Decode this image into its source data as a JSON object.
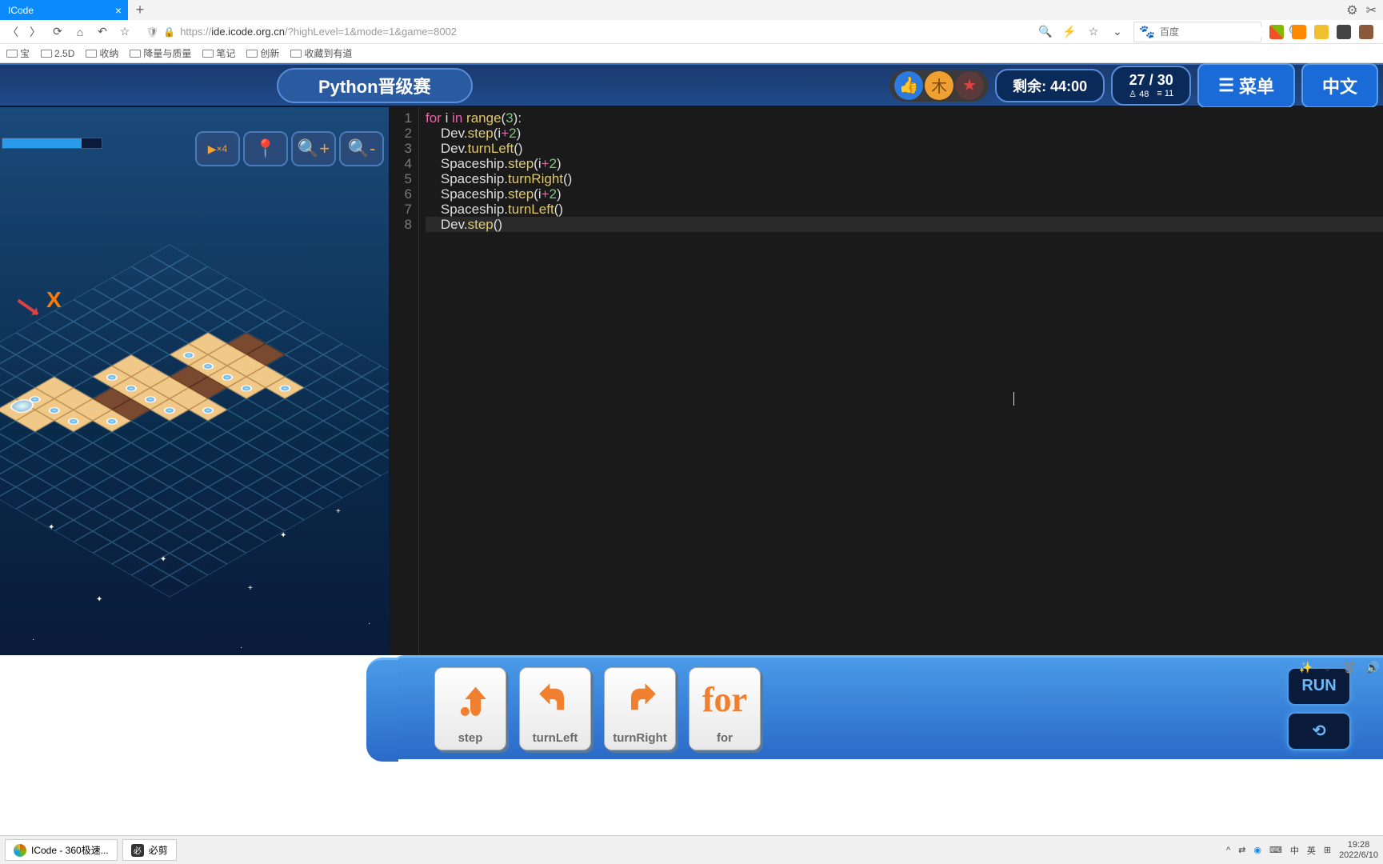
{
  "browser": {
    "tab_title": "ICode",
    "url_host": "ide.icode.org.cn",
    "url_path": "/?highLevel=1&mode=1&game=8002",
    "url_scheme": "https://",
    "search_placeholder": "百度",
    "bookmarks": [
      "宝",
      "2.5D",
      "收纳",
      "降量与质量",
      "笔记",
      "创新",
      "收藏到有道"
    ]
  },
  "header": {
    "title": "Python晋级赛",
    "timer_label": "剩余:",
    "timer_value": "44:00",
    "progress_cur": "27",
    "progress_total": "30",
    "stat_gold": "48",
    "stat_lines": "11",
    "menu_label": "菜单",
    "lang_label": "中文"
  },
  "game": {
    "x_label": "X",
    "btn_speed": "×4"
  },
  "code": {
    "lines": [
      {
        "n": "1",
        "indent": "",
        "tokens": [
          [
            "kw",
            "for"
          ],
          [
            "",
            " "
          ],
          [
            "",
            "i"
          ],
          [
            "",
            " "
          ],
          [
            "kw",
            "in"
          ],
          [
            "",
            " "
          ],
          [
            "fn",
            "range"
          ],
          [
            "",
            "("
          ],
          [
            "num",
            "3"
          ],
          [
            "",
            "):"
          ]
        ]
      },
      {
        "n": "2",
        "indent": "    ",
        "tokens": [
          [
            "",
            "Dev."
          ],
          [
            "fn",
            "step"
          ],
          [
            "",
            "(i"
          ],
          [
            "op",
            "+"
          ],
          [
            "num",
            "2"
          ],
          [
            "",
            ")"
          ]
        ]
      },
      {
        "n": "3",
        "indent": "    ",
        "tokens": [
          [
            "",
            "Dev."
          ],
          [
            "fn",
            "turnLeft"
          ],
          [
            "",
            "()"
          ]
        ]
      },
      {
        "n": "4",
        "indent": "    ",
        "tokens": [
          [
            "",
            "Spaceship."
          ],
          [
            "fn",
            "step"
          ],
          [
            "",
            "(i"
          ],
          [
            "op",
            "+"
          ],
          [
            "num",
            "2"
          ],
          [
            "",
            ")"
          ]
        ]
      },
      {
        "n": "5",
        "indent": "    ",
        "tokens": [
          [
            "",
            "Spaceship."
          ],
          [
            "fn",
            "turnRight"
          ],
          [
            "",
            "()"
          ]
        ]
      },
      {
        "n": "6",
        "indent": "    ",
        "tokens": [
          [
            "",
            "Spaceship."
          ],
          [
            "fn",
            "step"
          ],
          [
            "",
            "(i"
          ],
          [
            "op",
            "+"
          ],
          [
            "num",
            "2"
          ],
          [
            "",
            ")"
          ]
        ]
      },
      {
        "n": "7",
        "indent": "    ",
        "tokens": [
          [
            "",
            "Spaceship."
          ],
          [
            "fn",
            "turnLeft"
          ],
          [
            "",
            "()"
          ]
        ]
      },
      {
        "n": "8",
        "indent": "    ",
        "tokens": [
          [
            "",
            "Dev."
          ],
          [
            "fn",
            "step"
          ],
          [
            "",
            "()"
          ]
        ]
      }
    ]
  },
  "commands": {
    "step": "step",
    "turnLeft": "turnLeft",
    "turnRight": "turnRight",
    "for": "for",
    "for_icon": "for",
    "run": "RUN"
  },
  "taskbar": {
    "app1": "ICode - 360极速...",
    "app2": "必剪",
    "ime1": "中",
    "ime2": "英",
    "time": "19:28",
    "date": "2022/6/10"
  }
}
